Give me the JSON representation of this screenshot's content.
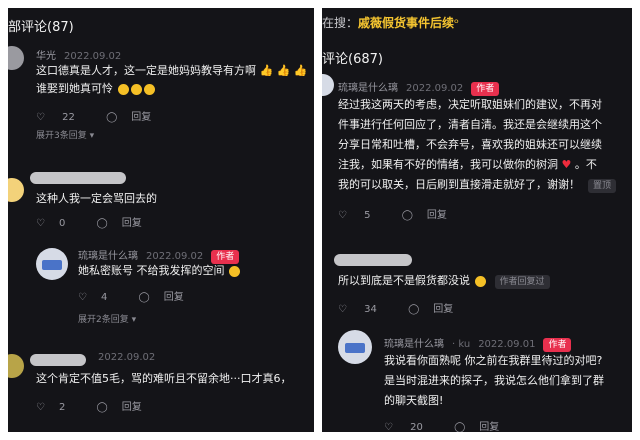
{
  "left": {
    "header": "部评论(87)",
    "c1": {
      "user": "华光",
      "time": "2022.09.02",
      "line1": "这口德真是人才，这一定是她妈妈教导有方啊",
      "line2": "谁娶到她真可怜",
      "likes": "22",
      "reply": "回复",
      "expand": "展开3条回复 ▾"
    },
    "c2": {
      "text": "这种人我一定会骂回去的",
      "likes": "0",
      "reply": "回复"
    },
    "r1": {
      "user": "琉璃是什么璃",
      "time": "2022.09.02",
      "badge": "作者",
      "text": "她私密账号 不给我发挥的空间",
      "likes": "4",
      "reply": "回复",
      "expand": "展开2条回复 ▾"
    },
    "c3": {
      "time": "2022.09.02",
      "text": "这个肯定不值5毛，骂的难听且不留余地···口才真6，",
      "likes": "2",
      "reply": "回复"
    }
  },
  "right": {
    "search_prefix": "在搜：",
    "search_term": "戚薇假货事件后续",
    "header": "评论(687)",
    "c1": {
      "user": "琉璃是什么璃",
      "time": "2022.09.02",
      "badge": "作者",
      "lines": [
        "经过我这两天的考虑，决定听取姐妹们的建议，不再对",
        "件事进行任何回应了，清者自清。我还是会继续用这个",
        "分享日常和吐槽，不会弃号，喜欢我的姐妹还可以继续",
        "注我，如果有不好的情绪，我可以做你的树洞",
        "我的可以取关，日后刷到直接滑走就好了，谢谢！"
      ],
      "line4_tail": "。不",
      "tag": "置顶",
      "likes": "5",
      "reply": "回复"
    },
    "c2": {
      "text": "所以到底是不是假货都没说",
      "tag": "作者回复过",
      "likes": "34",
      "reply": "回复"
    },
    "r1": {
      "user": "琉璃是什么璃",
      "via": "ku",
      "time": "2022.09.01",
      "badge": "作者",
      "lines": [
        "我说看你面熟呢 你之前在我群里待过的对吧?",
        "是当时混进来的探子，我说怎么他们拿到了群",
        "的聊天截图!"
      ],
      "likes": "20",
      "reply": "回复"
    }
  },
  "icons": {
    "like": "heart-outline-icon",
    "reply": "reply-bubble-icon",
    "search": "search-icon"
  },
  "colors": {
    "background": "#141418",
    "badge": "#e8304e",
    "search_highlight": "#f4c430"
  }
}
